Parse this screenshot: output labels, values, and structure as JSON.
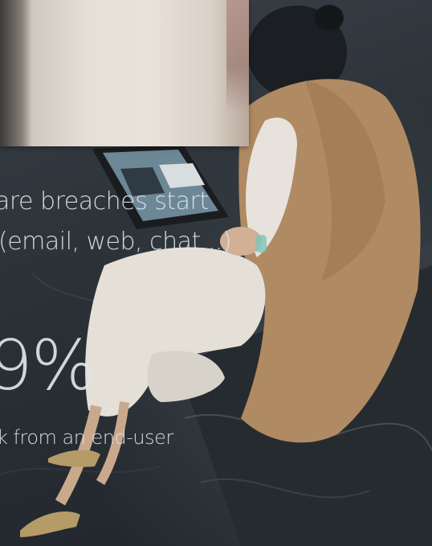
{
  "headline": {
    "line1": "are breaches start",
    "line2": "(email, web, chat...)"
  },
  "stat": {
    "number": "9%",
    "caption": "k from an end-user"
  },
  "colors": {
    "text": "#dfe6ea",
    "background": "#2a3036",
    "coat": "#b08a63"
  }
}
